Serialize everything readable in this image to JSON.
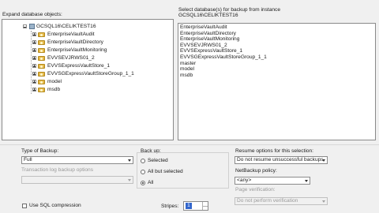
{
  "left_panel": {
    "header": "Expand database objects:",
    "server": "GCSQL16\\CELIKTEST16",
    "databases": [
      "EnterpriseVaultAudit",
      "EnterpriseVaultDirectory",
      "EnterpriseVaultMonitoring",
      "EVVSEVJRWS01_2",
      "EVVSExpressVaultStore_1",
      "EVVSGExpressVaultStoreGroup_1_1",
      "model",
      "msdb"
    ]
  },
  "right_panel": {
    "header_line1": "Select    database(s) for backup from instance",
    "header_line2": "GCSQL16\\CELIKTEST16",
    "items": [
      "EnterpriseVaultAudit",
      "EnterpriseVaultDirectory",
      "EnterpriseVaultMonitoring",
      "EVVSEVJRWS01_2",
      "EVVSExpressVaultStore_1",
      "EVVSGExpressVaultStoreGroup_1_1",
      "master",
      "model",
      "msdb"
    ]
  },
  "type_of_backup": {
    "label": "Type of Backup:",
    "value": "Full"
  },
  "transaction_log": {
    "label": "Transaction log backup options",
    "value": ""
  },
  "backup_up": {
    "label": "Back up:",
    "options": [
      "Selected",
      "All but selected",
      "All"
    ],
    "selected": "All"
  },
  "resume": {
    "label": "Resume options for this selection:",
    "value": "Do not resume unsuccessful backups"
  },
  "netbackup_policy": {
    "label": "NetBackup policy:",
    "value": "<any>"
  },
  "page_verification": {
    "label": "Page verification:",
    "value": "Do not perform verification"
  },
  "sql_compression": {
    "label": "Use SQL compression",
    "checked": false
  },
  "stripes": {
    "label": "Stripes:",
    "value": "1"
  }
}
